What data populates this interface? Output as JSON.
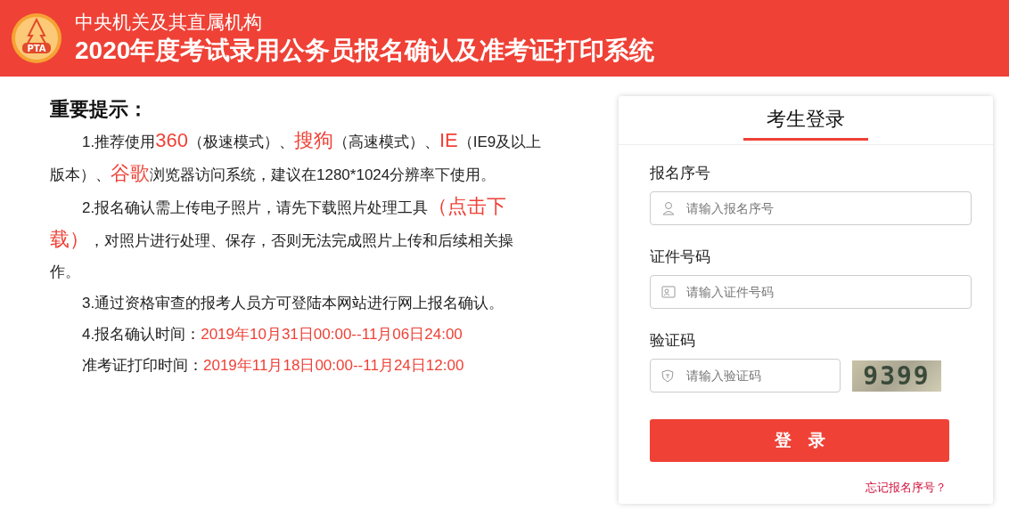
{
  "header": {
    "logo_text": "PTA",
    "subtitle": "中央机关及其直属机构",
    "title": "2020年度考试录用公务员报名确认及准考证打印系统"
  },
  "notice": {
    "heading": "重要提示：",
    "paragraphs": [
      {
        "segments": [
          {
            "kind": "plain",
            "text": "1.推荐使用"
          },
          {
            "kind": "big",
            "text": "360"
          },
          {
            "kind": "plain",
            "text": "（极速模式）、"
          },
          {
            "kind": "big",
            "text": "搜狗"
          },
          {
            "kind": "plain",
            "text": "（高速模式）、"
          },
          {
            "kind": "big",
            "text": "IE"
          },
          {
            "kind": "plain",
            "text": "（IE9及以上版本）、"
          },
          {
            "kind": "big",
            "text": "谷歌"
          },
          {
            "kind": "plain",
            "text": "浏览器访问系统，建议在1280*1024分辨率下使用。"
          }
        ]
      },
      {
        "segments": [
          {
            "kind": "plain",
            "text": "2.报名确认需上传电子照片，请先下载照片处理工具"
          },
          {
            "kind": "big",
            "text": "（点击下载）"
          },
          {
            "kind": "plain",
            "text": "，对照片进行处理、保存，否则无法完成照片上传和后续相关操作。"
          }
        ]
      },
      {
        "segments": [
          {
            "kind": "plain",
            "text": "3.通过资格审查的报考人员方可登陆本网站进行网上报名确认。"
          }
        ]
      },
      {
        "segments": [
          {
            "kind": "plain",
            "text": "4.报名确认时间："
          },
          {
            "kind": "red",
            "text": "2019年10月31日00:00--11月06日24:00"
          }
        ]
      },
      {
        "segments": [
          {
            "kind": "plain",
            "text": "准考证打印时间："
          },
          {
            "kind": "red",
            "text": "2019年11月18日00:00--11月24日12:00"
          }
        ]
      }
    ]
  },
  "login": {
    "tab": "考生登录",
    "fields": [
      {
        "kind": "user",
        "label": "报名序号",
        "placeholder": "请输入报名序号"
      },
      {
        "kind": "id",
        "label": "证件号码",
        "placeholder": "请输入证件号码"
      },
      {
        "kind": "captcha",
        "label": "验证码",
        "placeholder": "请输入验证码",
        "captcha": "9399"
      }
    ],
    "submit": "登　录",
    "forgot": "忘记报名序号？"
  }
}
